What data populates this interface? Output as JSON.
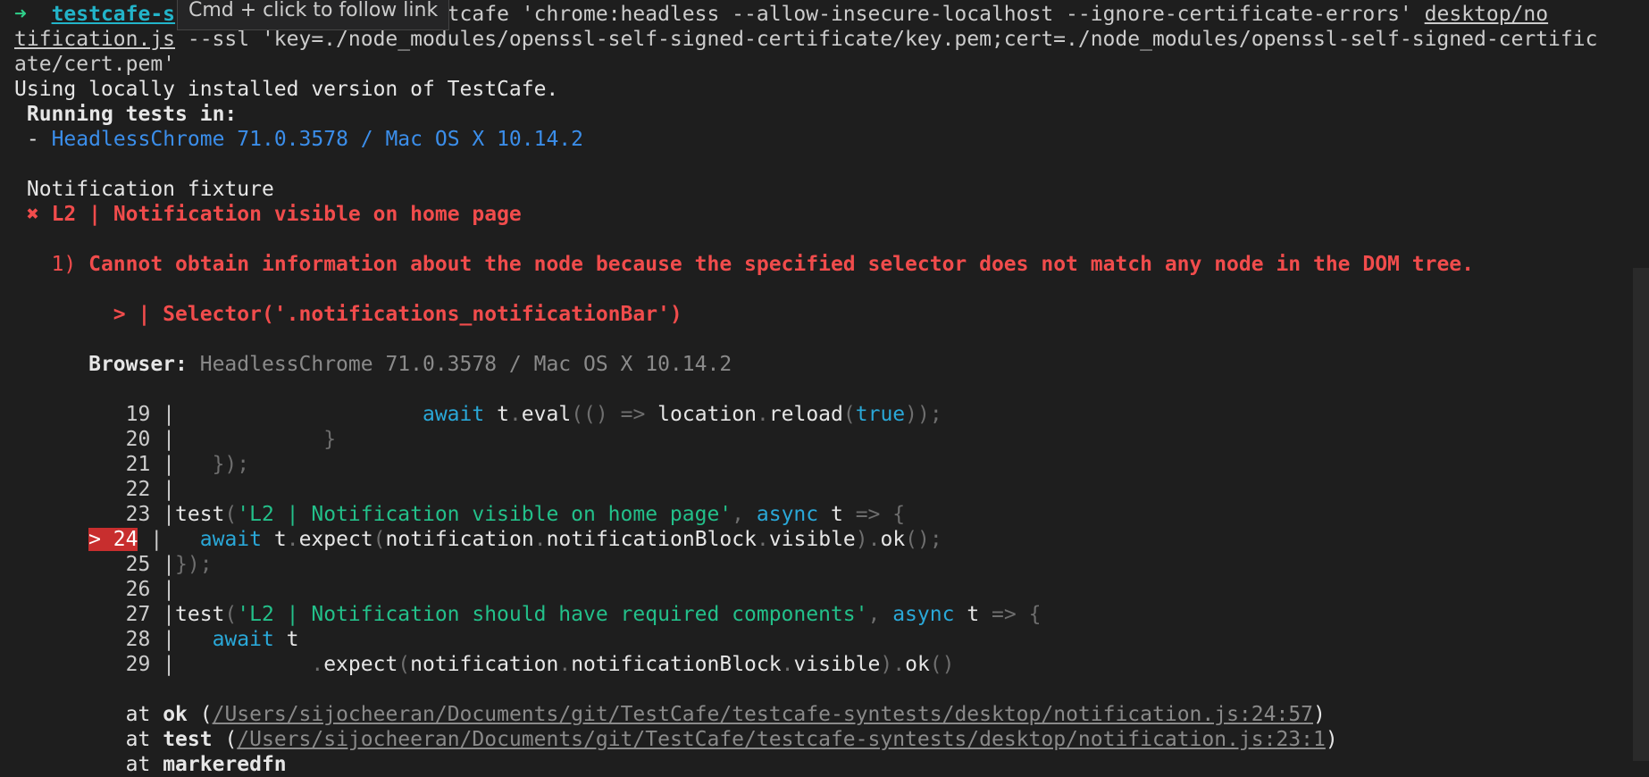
{
  "tooltip": "Cmd + click to follow link",
  "prompt": {
    "arrow": "➜",
    "dir": "testcafe-s",
    "cmd": " testcafe 'chrome:headless --allow-insecure-localhost --ignore-certificate-errors' ",
    "file_part1": "desktop/no",
    "file_part2": "tification.js",
    "line2_rest": " --ssl 'key=./node_modules/openssl-self-signed-certificate/key.pem;cert=./node_modules/openssl-self-signed-certific",
    "line3": "ate/cert.pem'"
  },
  "using_local": "Using locally installed version of TestCafe.",
  "running_tests": "Running tests in:",
  "browser_bullet": "-",
  "browser_name": "HeadlessChrome 71.0.3578 / Mac OS X 10.14.2",
  "fixture": "Notification fixture",
  "fail": {
    "mark": "✖",
    "name": "L2 | Notification visible on home page"
  },
  "error": {
    "num": "1)",
    "message": "Cannot obtain information about the node because the specified selector does not match any node in the DOM tree.",
    "selector": "> | Selector('.notifications_notificationBar')",
    "browser_label": "Browser:",
    "browser_value": "HeadlessChrome 71.0.3578 / Mac OS X 10.14.2"
  },
  "code": {
    "l19_num": "19 |",
    "l19_await": "await",
    "l19_t": "t",
    "l19_dot": ".",
    "l19_eval": "eval",
    "l19_p1": "(()",
    "l19_arrow": "=>",
    "l19_loc": "location",
    "l19_dot2": ".",
    "l19_reload": "reload",
    "l19_p2": "(",
    "l19_true": "true",
    "l19_p3": "));",
    "l20_num": "20 |",
    "l20_brace": "}",
    "l21_num": "21 |",
    "l21_text": "});",
    "l22_num": "22 |",
    "l23_num": "23 |",
    "l23_test": "test",
    "l23_p": "(",
    "l23_str": "'L2 | Notification visible on home page'",
    "l23_comma": ",",
    "l23_async": "async",
    "l23_t": "t",
    "l23_arrow": "=> {",
    "l24_num": "> 24",
    "l24_bar": "|",
    "l24_await": "await",
    "l24_t": "t",
    "l24_d1": ".",
    "l24_expect": "expect",
    "l24_p1": "(",
    "l24_notif": "notification",
    "l24_d2": ".",
    "l24_block": "notificationBlock",
    "l24_d3": ".",
    "l24_vis": "visible",
    "l24_p2": ").",
    "l24_ok": "ok",
    "l24_p3": "();",
    "l25_num": "25 |",
    "l25_text": "});",
    "l26_num": "26 |",
    "l27_num": "27 |",
    "l27_test": "test",
    "l27_p": "(",
    "l27_str": "'L2 | Notification should have required components'",
    "l27_comma": ",",
    "l27_async": "async",
    "l27_t": "t",
    "l27_arrow": "=> {",
    "l28_num": "28 |",
    "l28_await": "await",
    "l28_t": "t",
    "l29_num": "29 |",
    "l29_d1": ".",
    "l29_expect": "expect",
    "l29_p1": "(",
    "l29_notif": "notification",
    "l29_d2": ".",
    "l29_block": "notificationBlock",
    "l29_d3": ".",
    "l29_vis": "visible",
    "l29_p2": ").",
    "l29_ok": "ok",
    "l29_p3": "()"
  },
  "stack": [
    {
      "at": "at",
      "fn": "ok",
      "open": "(",
      "path": "/Users/sijocheeran/Documents/git/TestCafe/testcafe-syntests/desktop/notification.js:24:57",
      "close": ")"
    },
    {
      "at": "at",
      "fn": "test",
      "open": "(",
      "path": "/Users/sijocheeran/Documents/git/TestCafe/testcafe-syntests/desktop/notification.js:23:1",
      "close": ")"
    },
    {
      "at": "at",
      "fn": "markeredfn"
    }
  ]
}
